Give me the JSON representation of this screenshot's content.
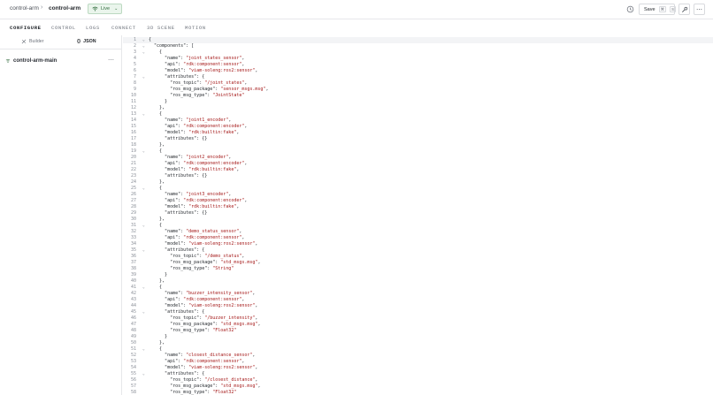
{
  "header": {
    "breadcrumb_org": "control-arm",
    "breadcrumb_sep": "›",
    "breadcrumb_machine": "control-arm",
    "live_label": "Live",
    "save_label": "Save",
    "save_shortcut_1": "⌘",
    "save_shortcut_2": "S"
  },
  "nav": {
    "tabs": [
      "CONFIGURE",
      "CONTROL",
      "LOGS",
      "CONNECT",
      "3D SCENE",
      "MOTION"
    ],
    "active": "CONFIGURE"
  },
  "left_panel": {
    "builder_label": "Builder",
    "json_label": "JSON",
    "active_mode": "JSON",
    "tree_item": "control-arm-main",
    "more": "⋯"
  },
  "editor": {
    "lines": [
      {
        "n": "1",
        "fold": true,
        "t": "{"
      },
      {
        "n": "2",
        "fold": true,
        "t": "  \"components\": ["
      },
      {
        "n": "3",
        "fold": true,
        "t": "    {"
      },
      {
        "n": "4",
        "fold": false,
        "t": "      \"name\": \"joint_states_sensor\","
      },
      {
        "n": "5",
        "fold": false,
        "t": "      \"api\": \"rdk:component:sensor\","
      },
      {
        "n": "6",
        "fold": false,
        "t": "      \"model\": \"viam-soleng:ros2:sensor\","
      },
      {
        "n": "7",
        "fold": true,
        "t": "      \"attributes\": {"
      },
      {
        "n": "8",
        "fold": false,
        "t": "        \"ros_topic\": \"/joint_states\","
      },
      {
        "n": "9",
        "fold": false,
        "t": "        \"ros_msg_package\": \"sensor_msgs.msg\","
      },
      {
        "n": "10",
        "fold": false,
        "t": "        \"ros_msg_type\": \"JointState\""
      },
      {
        "n": "11",
        "fold": false,
        "t": "      }"
      },
      {
        "n": "12",
        "fold": false,
        "t": "    },"
      },
      {
        "n": "13",
        "fold": true,
        "t": "    {"
      },
      {
        "n": "14",
        "fold": false,
        "t": "      \"name\": \"joint1_encoder\","
      },
      {
        "n": "15",
        "fold": false,
        "t": "      \"api\": \"rdk:component:encoder\","
      },
      {
        "n": "16",
        "fold": false,
        "t": "      \"model\": \"rdk:builtin:fake\","
      },
      {
        "n": "17",
        "fold": false,
        "t": "      \"attributes\": {}"
      },
      {
        "n": "18",
        "fold": false,
        "t": "    },"
      },
      {
        "n": "19",
        "fold": true,
        "t": "    {"
      },
      {
        "n": "20",
        "fold": false,
        "t": "      \"name\": \"joint2_encoder\","
      },
      {
        "n": "21",
        "fold": false,
        "t": "      \"api\": \"rdk:component:encoder\","
      },
      {
        "n": "22",
        "fold": false,
        "t": "      \"model\": \"rdk:builtin:fake\","
      },
      {
        "n": "23",
        "fold": false,
        "t": "      \"attributes\": {}"
      },
      {
        "n": "24",
        "fold": false,
        "t": "    },"
      },
      {
        "n": "25",
        "fold": true,
        "t": "    {"
      },
      {
        "n": "26",
        "fold": false,
        "t": "      \"name\": \"joint3_encoder\","
      },
      {
        "n": "27",
        "fold": false,
        "t": "      \"api\": \"rdk:component:encoder\","
      },
      {
        "n": "28",
        "fold": false,
        "t": "      \"model\": \"rdk:builtin:fake\","
      },
      {
        "n": "29",
        "fold": false,
        "t": "      \"attributes\": {}"
      },
      {
        "n": "30",
        "fold": false,
        "t": "    },"
      },
      {
        "n": "31",
        "fold": true,
        "t": "    {"
      },
      {
        "n": "32",
        "fold": false,
        "t": "      \"name\": \"demo_status_sensor\","
      },
      {
        "n": "33",
        "fold": false,
        "t": "      \"api\": \"rdk:component:sensor\","
      },
      {
        "n": "34",
        "fold": false,
        "t": "      \"model\": \"viam-soleng:ros2:sensor\","
      },
      {
        "n": "35",
        "fold": true,
        "t": "      \"attributes\": {"
      },
      {
        "n": "36",
        "fold": false,
        "t": "        \"ros_topic\": \"/demo_status\","
      },
      {
        "n": "37",
        "fold": false,
        "t": "        \"ros_msg_package\": \"std_msgs.msg\","
      },
      {
        "n": "38",
        "fold": false,
        "t": "        \"ros_msg_type\": \"String\""
      },
      {
        "n": "39",
        "fold": false,
        "t": "      }"
      },
      {
        "n": "40",
        "fold": false,
        "t": "    },"
      },
      {
        "n": "41",
        "fold": true,
        "t": "    {"
      },
      {
        "n": "42",
        "fold": false,
        "t": "      \"name\": \"buzzer_intensity_sensor\","
      },
      {
        "n": "43",
        "fold": false,
        "t": "      \"api\": \"rdk:component:sensor\","
      },
      {
        "n": "44",
        "fold": false,
        "t": "      \"model\": \"viam-soleng:ros2:sensor\","
      },
      {
        "n": "45",
        "fold": true,
        "t": "      \"attributes\": {"
      },
      {
        "n": "46",
        "fold": false,
        "t": "        \"ros_topic\": \"/buzzer_intensity\","
      },
      {
        "n": "47",
        "fold": false,
        "t": "        \"ros_msg_package\": \"std_msgs.msg\","
      },
      {
        "n": "48",
        "fold": false,
        "t": "        \"ros_msg_type\": \"Float32\""
      },
      {
        "n": "49",
        "fold": false,
        "t": "      }"
      },
      {
        "n": "50",
        "fold": false,
        "t": "    },"
      },
      {
        "n": "51",
        "fold": true,
        "t": "    {"
      },
      {
        "n": "52",
        "fold": false,
        "t": "      \"name\": \"closest_distance_sensor\","
      },
      {
        "n": "53",
        "fold": false,
        "t": "      \"api\": \"rdk:component:sensor\","
      },
      {
        "n": "54",
        "fold": false,
        "t": "      \"model\": \"viam-soleng:ros2:sensor\","
      },
      {
        "n": "55",
        "fold": true,
        "t": "      \"attributes\": {"
      },
      {
        "n": "56",
        "fold": false,
        "t": "        \"ros_topic\": \"/closest_distance\","
      },
      {
        "n": "57",
        "fold": false,
        "t": "        \"ros_msg_package\": \"std_msgs.msg\","
      },
      {
        "n": "58",
        "fold": false,
        "t": "        \"ros_msg_type\": \"Float32\""
      }
    ]
  }
}
